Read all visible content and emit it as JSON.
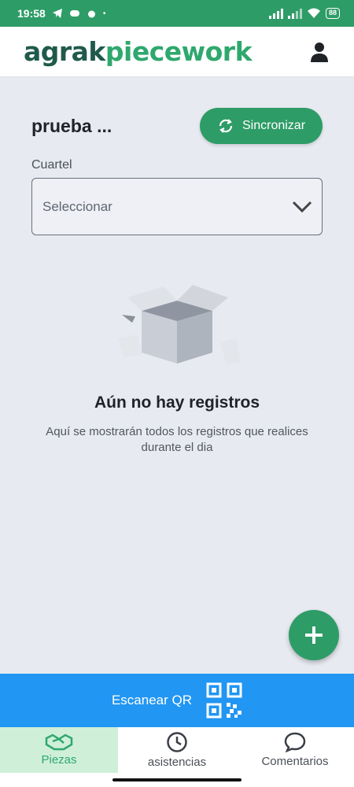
{
  "status_bar": {
    "time": "19:58",
    "battery": "88"
  },
  "header": {
    "logo_part1": "agrak",
    "logo_part2": "piecework"
  },
  "main": {
    "title": "prueba ...",
    "sync_label": "Sincronizar",
    "field_label": "Cuartel",
    "select_value": "Seleccionar",
    "empty_title": "Aún no hay registros",
    "empty_desc": "Aquí se mostrarán todos los registros que realices durante el dia"
  },
  "scan": {
    "label": "Escanear QR"
  },
  "nav": [
    {
      "label": "Piezas",
      "icon": "handshake-icon"
    },
    {
      "label": "asistencias",
      "icon": "clock-icon"
    },
    {
      "label": "Comentarios",
      "icon": "comment-icon"
    }
  ],
  "colors": {
    "primary": "#2e9c67",
    "scan": "#2196f3",
    "active_tab_bg": "#cfefd9"
  }
}
